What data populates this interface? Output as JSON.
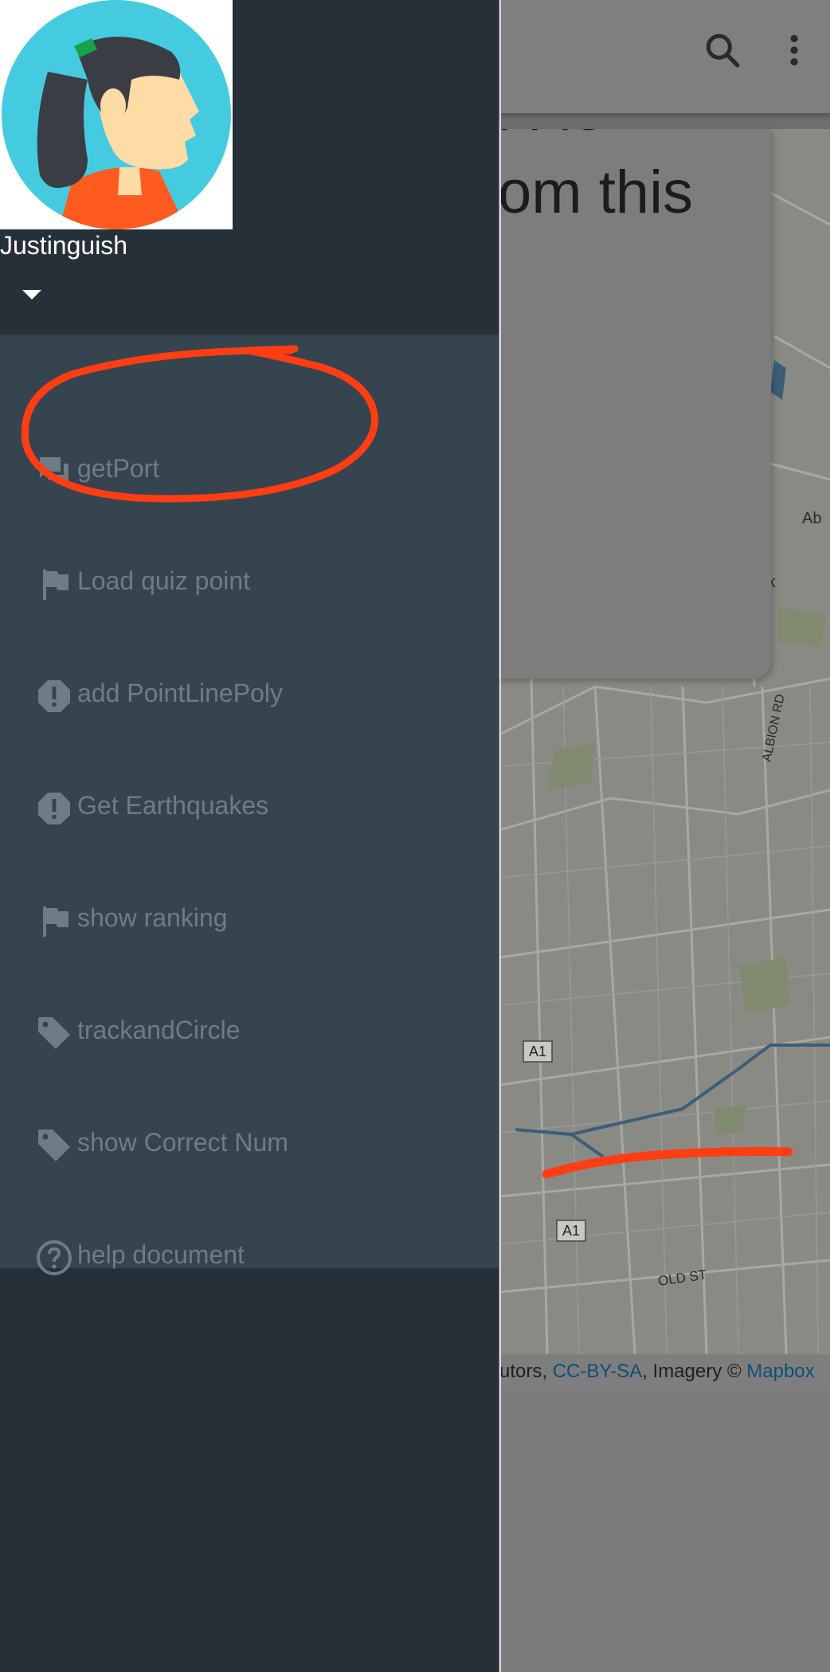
{
  "app": {
    "map_card_text_top": "i i io",
    "map_card_text": "om this",
    "attribution": {
      "prefix": "utors, ",
      "link1": "CC-BY-SA",
      "middle": ", Imagery © ",
      "link2": "Mapbox"
    },
    "map_labels": {
      "albion": "ALBION RD",
      "ab": "Ab",
      "rk": "rk",
      "a1_top": "A1",
      "a1_bottom": "A1",
      "old_st": "OLD ST"
    }
  },
  "drawer": {
    "username": "Justinguish",
    "items": [
      {
        "label": "getPort",
        "icon": "forum-icon"
      },
      {
        "label": "Load quiz point",
        "icon": "flag-icon"
      },
      {
        "label": "add PointLinePoly",
        "icon": "alert-octagon-icon"
      },
      {
        "label": "Get Earthquakes",
        "icon": "alert-octagon-icon"
      },
      {
        "label": "show ranking",
        "icon": "flag-icon"
      },
      {
        "label": "trackandCircle",
        "icon": "tag-icon"
      },
      {
        "label": "show Correct Num",
        "icon": "tag-icon"
      },
      {
        "label": "help document",
        "icon": "help-circle-icon"
      }
    ]
  },
  "colors": {
    "drawer_header": "#263038",
    "drawer_menu": "#35444e",
    "menu_text": "#6d7c86",
    "annotation": "#ff3d12"
  }
}
